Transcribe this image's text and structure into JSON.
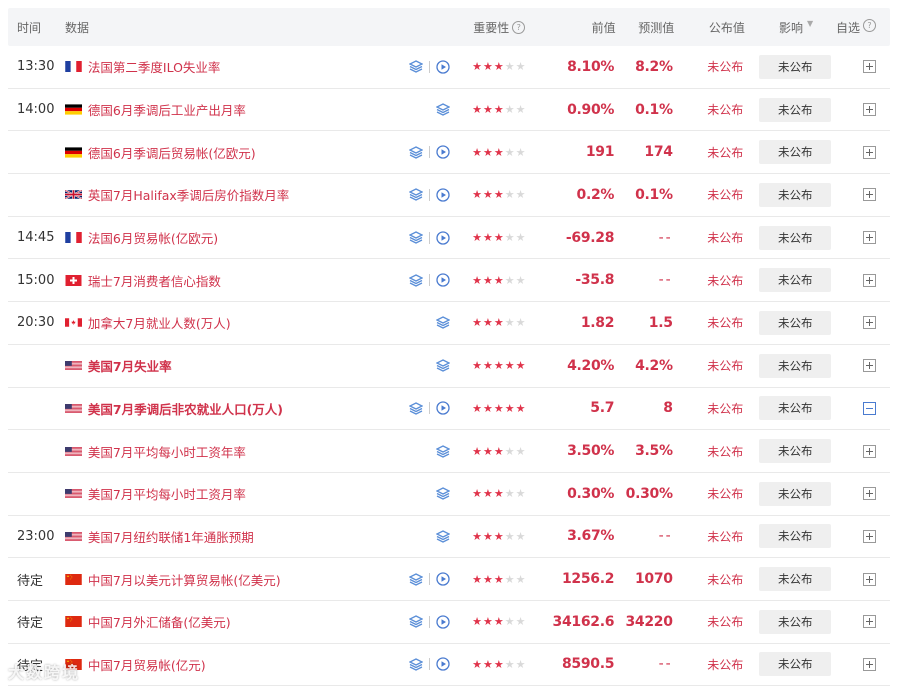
{
  "header": {
    "time": "时间",
    "data": "数据",
    "importance": "重要性",
    "previous": "前值",
    "forecast": "预测值",
    "published": "公布值",
    "effect": "影响",
    "watchlist": "自选"
  },
  "rows": [
    {
      "time": "13:30",
      "flag": "fr",
      "name": "法国第二季度ILO失业率",
      "bold": false,
      "tools": [
        "layers",
        "play"
      ],
      "stars": 3,
      "prev": "8.10%",
      "fore": "8.2%",
      "pub": "未公布",
      "effect": "未公布",
      "watch": "plus"
    },
    {
      "time": "14:00",
      "flag": "de",
      "name": "德国6月季调后工业产出月率",
      "bold": false,
      "tools": [
        "layers"
      ],
      "stars": 3,
      "prev": "0.90%",
      "fore": "0.1%",
      "pub": "未公布",
      "effect": "未公布",
      "watch": "plus"
    },
    {
      "time": "",
      "flag": "de",
      "name": "德国6月季调后贸易帐(亿欧元)",
      "bold": false,
      "tools": [
        "layers",
        "play"
      ],
      "stars": 3,
      "prev": "191",
      "fore": "174",
      "pub": "未公布",
      "effect": "未公布",
      "watch": "plus"
    },
    {
      "time": "",
      "flag": "gb",
      "name": "英国7月Halifax季调后房价指数月率",
      "bold": false,
      "tools": [
        "layers",
        "play"
      ],
      "stars": 3,
      "prev": "0.2%",
      "fore": "0.1%",
      "pub": "未公布",
      "effect": "未公布",
      "watch": "plus"
    },
    {
      "time": "14:45",
      "flag": "fr",
      "name": "法国6月贸易帐(亿欧元)",
      "bold": false,
      "tools": [
        "layers",
        "play"
      ],
      "stars": 3,
      "prev": "-69.28",
      "fore": "--",
      "pub": "未公布",
      "effect": "未公布",
      "watch": "plus"
    },
    {
      "time": "15:00",
      "flag": "ch",
      "name": "瑞士7月消费者信心指数",
      "bold": false,
      "tools": [
        "layers",
        "play"
      ],
      "stars": 3,
      "prev": "-35.8",
      "fore": "--",
      "pub": "未公布",
      "effect": "未公布",
      "watch": "plus"
    },
    {
      "time": "20:30",
      "flag": "ca",
      "name": "加拿大7月就业人数(万人)",
      "bold": false,
      "tools": [
        "layers"
      ],
      "stars": 3,
      "prev": "1.82",
      "fore": "1.5",
      "pub": "未公布",
      "effect": "未公布",
      "watch": "plus"
    },
    {
      "time": "",
      "flag": "us",
      "name": "美国7月失业率",
      "bold": true,
      "tools": [
        "layers"
      ],
      "stars": 5,
      "prev": "4.20%",
      "fore": "4.2%",
      "pub": "未公布",
      "effect": "未公布",
      "watch": "plus"
    },
    {
      "time": "",
      "flag": "us",
      "name": "美国7月季调后非农就业人口(万人)",
      "bold": true,
      "tools": [
        "layers",
        "play"
      ],
      "stars": 5,
      "prev": "5.7",
      "fore": "8",
      "pub": "未公布",
      "effect": "未公布",
      "watch": "minus"
    },
    {
      "time": "",
      "flag": "us",
      "name": "美国7月平均每小时工资年率",
      "bold": false,
      "tools": [
        "layers"
      ],
      "stars": 3,
      "prev": "3.50%",
      "fore": "3.5%",
      "pub": "未公布",
      "effect": "未公布",
      "watch": "plus"
    },
    {
      "time": "",
      "flag": "us",
      "name": "美国7月平均每小时工资月率",
      "bold": false,
      "tools": [
        "layers"
      ],
      "stars": 3,
      "prev": "0.30%",
      "fore": "0.30%",
      "pub": "未公布",
      "effect": "未公布",
      "watch": "plus"
    },
    {
      "time": "23:00",
      "flag": "us",
      "name": "美国7月纽约联储1年通胀预期",
      "bold": false,
      "tools": [
        "layers"
      ],
      "stars": 3,
      "prev": "3.67%",
      "fore": "--",
      "pub": "未公布",
      "effect": "未公布",
      "watch": "plus"
    },
    {
      "time": "待定",
      "flag": "cn",
      "name": "中国7月以美元计算贸易帐(亿美元)",
      "bold": false,
      "tools": [
        "layers",
        "play"
      ],
      "stars": 3,
      "prev": "1256.2",
      "fore": "1070",
      "pub": "未公布",
      "effect": "未公布",
      "watch": "plus"
    },
    {
      "time": "待定",
      "flag": "cn",
      "name": "中国7月外汇储备(亿美元)",
      "bold": false,
      "tools": [
        "layers",
        "play"
      ],
      "stars": 3,
      "prev": "34162.6",
      "fore": "34220",
      "pub": "未公布",
      "effect": "未公布",
      "watch": "plus"
    },
    {
      "time": "待定",
      "flag": "cn",
      "name": "中国7月贸易帐(亿元)",
      "bold": false,
      "tools": [
        "layers",
        "play"
      ],
      "stars": 3,
      "prev": "8590.5",
      "fore": "--",
      "pub": "未公布",
      "effect": "未公布",
      "watch": "plus"
    }
  ],
  "colors": {
    "accent": "#d0324b",
    "star_on": "#e0334a",
    "star_off": "#d9d9d9"
  },
  "watermark": "大数跨境"
}
